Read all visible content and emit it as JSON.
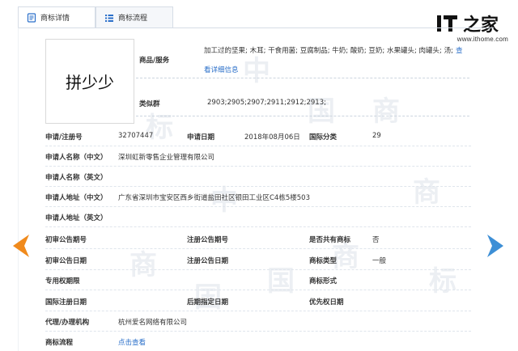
{
  "tabs": [
    {
      "label": "商标详情",
      "icon": "document-icon",
      "active": true
    },
    {
      "label": "商标流程",
      "icon": "list-icon",
      "active": false
    }
  ],
  "watermark": {
    "url": "www.ithome.com",
    "logo_text": "IT之家"
  },
  "mark": {
    "name": "拼少少"
  },
  "goods": {
    "label": "商品/服务",
    "text": "加工过的坚果; 木耳; 干食用菌; 豆腐制品; 牛奶; 酸奶; 豆奶; 水果罐头; 肉罐头; 汤;",
    "more_link": "查",
    "detail_link": "看详细信息"
  },
  "similar": {
    "label": "类似群",
    "value": "2903;2905;2907;2911;2912;2913;"
  },
  "rows": [
    {
      "cells": [
        {
          "label": "申请/注册号",
          "value": "32707447"
        },
        {
          "label": "申请日期",
          "value": "2018年08月06日"
        },
        {
          "label": "国际分类",
          "value": "29"
        }
      ]
    },
    {
      "cells": [
        {
          "label": "申请人名称（中文）",
          "value": "深圳虹新零售企业管理有限公司"
        }
      ]
    },
    {
      "cells": [
        {
          "label": "申请人名称（英文）",
          "value": ""
        }
      ]
    },
    {
      "cells": [
        {
          "label": "申请人地址（中文）",
          "value": "广东省深圳市宝安区西乡街道盐田社区银田工业区C4栋5楼503"
        }
      ]
    },
    {
      "cells": [
        {
          "label": "申请人地址（英文）",
          "value": ""
        }
      ]
    },
    {
      "cells": [
        {
          "label": "初审公告期号",
          "value": ""
        },
        {
          "label": "注册公告期号",
          "value": ""
        },
        {
          "label": "是否共有商标",
          "value": "否"
        }
      ]
    },
    {
      "cells": [
        {
          "label": "初审公告日期",
          "value": ""
        },
        {
          "label": "注册公告日期",
          "value": ""
        },
        {
          "label": "商标类型",
          "value": "一般"
        }
      ]
    },
    {
      "cells": [
        {
          "label": "专用权期限",
          "value": ""
        },
        {
          "label": "",
          "value": ""
        },
        {
          "label": "商标形式",
          "value": ""
        }
      ]
    },
    {
      "cells": [
        {
          "label": "国际注册日期",
          "value": ""
        },
        {
          "label": "后期指定日期",
          "value": ""
        },
        {
          "label": "优先权日期",
          "value": ""
        }
      ]
    },
    {
      "cells": [
        {
          "label": "代理/办理机构",
          "value": "杭州爱名网络有限公司"
        }
      ]
    },
    {
      "cells": [
        {
          "label": "商标流程",
          "value": "点击查看"
        }
      ]
    }
  ],
  "watermark_chars": [
    "中",
    "国",
    "商",
    "标"
  ],
  "colors": {
    "link": "#2a6fc9",
    "arrow_left": "#f08a1c",
    "arrow_right": "#3d8fd6",
    "border": "#d6dde6"
  }
}
